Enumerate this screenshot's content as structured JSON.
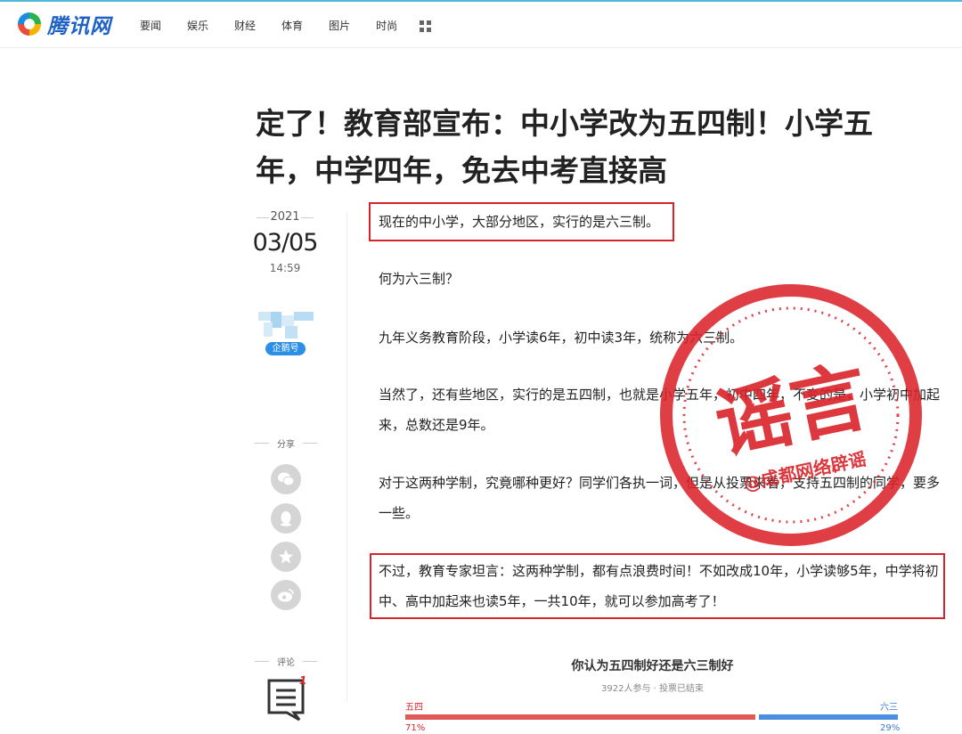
{
  "header": {
    "logo_text": "腾讯网",
    "nav": [
      "要闻",
      "娱乐",
      "财经",
      "体育",
      "图片",
      "时尚"
    ]
  },
  "article": {
    "title": "定了！教育部宣布：中小学改为五四制！小学五年，中学四年，免去中考直接高",
    "year": "2021",
    "month_day": "03/05",
    "time": "14:59",
    "author_badge": "企鹅号",
    "share_label": "分享",
    "comment_label": "评论",
    "comment_count": "1",
    "paragraphs": [
      "现在的中小学，大部分地区，实行的是六三制。",
      "何为六三制？",
      "九年义务教育阶段，小学读6年，初中读3年，统称为六三制。",
      "当然了，还有些地区，实行的是五四制，也就是小学五年，初中四年，不变的是，小学初中加起来，总数还是9年。",
      "对于这两种学制，究竟哪种更好？同学们各执一词，但是从投票来看，支持五四制的同学，要多一些。",
      "不过，教育专家坦言：这两种学制，都有点浪费时间！不如改成10年，小学读够5年，中学将初中、高中加起来也读5年，一共10年，就可以参加高考了！"
    ]
  },
  "poll": {
    "title": "你认为五四制好还是六三制好",
    "subtitle": "3922人参与 · 投票已结束",
    "left_label": "五四",
    "right_label": "六三",
    "left_pct": "71%",
    "right_pct": "29%",
    "left_fraction": 0.71
  },
  "stamp": {
    "main_text": "谣言",
    "source_text": "@成都网络辟谣",
    "color": "#d9232a"
  },
  "colors": {
    "accent": "#d9232a",
    "brand": "#1e62c6"
  }
}
